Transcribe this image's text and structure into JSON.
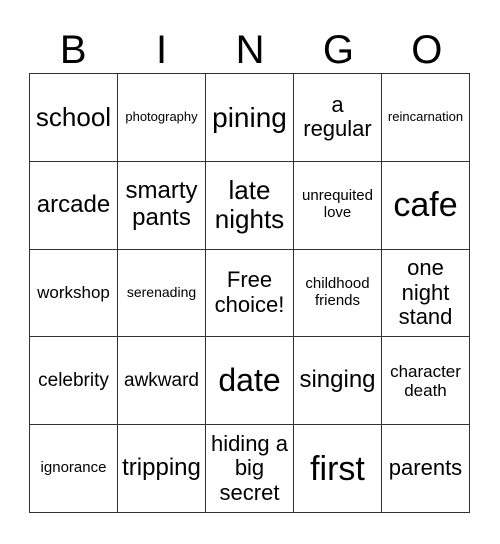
{
  "header": [
    "B",
    "I",
    "N",
    "G",
    "O"
  ],
  "cells": [
    "school",
    "photography",
    "pining",
    "a regular",
    "reincarnation",
    "arcade",
    "smarty pants",
    "late nights",
    "unrequited love",
    "cafe",
    "workshop",
    "serenading",
    "Free choice!",
    "childhood friends",
    "one night stand",
    "celebrity",
    "awkward",
    "date",
    "singing",
    "character death",
    "ignorance",
    "tripping",
    "hiding a big secret",
    "first",
    "parents"
  ]
}
